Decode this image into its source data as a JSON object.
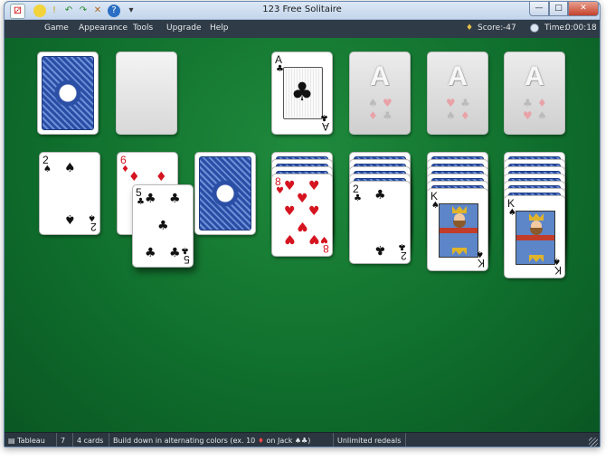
{
  "window": {
    "title": "123 Free Solitaire"
  },
  "titlebar": {
    "quick_access_icons": [
      "new-game-icon",
      "hint-icon",
      "undo-icon",
      "redo-icon",
      "tools-icon",
      "help-icon"
    ],
    "controls": {
      "minimize": "—",
      "maximize": "□",
      "close": "✕"
    }
  },
  "menu": {
    "items": [
      "Game",
      "Appearance",
      "Tools",
      "Upgrade",
      "Help"
    ]
  },
  "stats": {
    "score_label": "Score:",
    "score": "-47",
    "time_label": "Time:",
    "time": "0:00:18"
  },
  "cards": {
    "ace_clubs": {
      "rank": "A",
      "suit": "♣"
    },
    "two_spades": {
      "rank": "2",
      "suit": "♠"
    },
    "six_diamonds": {
      "rank": "6",
      "suit": "♦"
    },
    "five_clubs": {
      "rank": "5",
      "suit": "♣"
    },
    "eight_hearts": {
      "rank": "8",
      "suit": "♥"
    },
    "two_clubs": {
      "rank": "2",
      "suit": "♣"
    },
    "king_spades_a": {
      "rank": "K",
      "suit": "♠"
    },
    "king_spades_b": {
      "rank": "K",
      "suit": "♠"
    },
    "foundation_placeholder": {
      "rank": "A",
      "suits": [
        "♠",
        "♥",
        "♣",
        "♦"
      ]
    }
  },
  "colors": {
    "felt": "#0f6b2b",
    "red_suit": "#d51420",
    "black_suit": "#111111",
    "card_back": "#2a4ea5"
  },
  "status": {
    "mode": "Tableau",
    "column": "7",
    "cards": "4 cards",
    "rule_prefix": "Build down in alternating colors (ex. 10",
    "rule_suit": "♦",
    "rule_suffix": "on Jack ♠♣)",
    "redeals": "Unlimited redeals"
  }
}
